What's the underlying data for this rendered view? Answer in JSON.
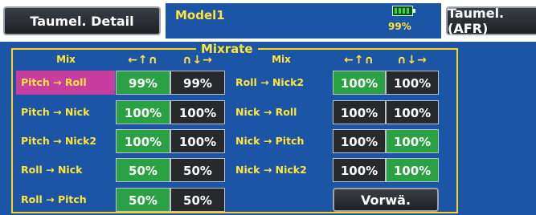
{
  "header": {
    "title_button": "Taumel. Detail",
    "model_name": "Model1",
    "battery_percent": "99%",
    "battery_level": 0.99,
    "function_button": "Taumel.(AFR)"
  },
  "mixrate": {
    "title": "Mixrate",
    "col_mix": "Mix",
    "col_left": "←↑∩",
    "col_right": "∩↓→",
    "left_rows": [
      {
        "label": "Pitch → Roll",
        "v1": "99%",
        "v2": "99%"
      },
      {
        "label": "Pitch → Nick",
        "v1": "100%",
        "v2": "100%"
      },
      {
        "label": "Pitch → Nick2",
        "v1": "100%",
        "v2": "100%"
      },
      {
        "label": "Roll → Nick",
        "v1": "50%",
        "v2": "50%"
      },
      {
        "label": "Roll → Pitch",
        "v1": "50%",
        "v2": "50%"
      }
    ],
    "right_rows": [
      {
        "label": "Roll → Nick2",
        "v1": "100%",
        "v2": "100%"
      },
      {
        "label": "Nick → Roll",
        "v1": "100%",
        "v2": "100%"
      },
      {
        "label": "Nick → Pitch",
        "v1": "100%",
        "v2": "100%"
      },
      {
        "label": "Nick → Nick2",
        "v1": "100%",
        "v2": "100%"
      }
    ],
    "next_button": "Vorwä."
  },
  "colors": {
    "screen": "#1c55a6",
    "label_text": "#ffe63a",
    "green_cell": "#2aa143",
    "dark_cell": "#27292c",
    "selected_label": "#c83ea0"
  }
}
